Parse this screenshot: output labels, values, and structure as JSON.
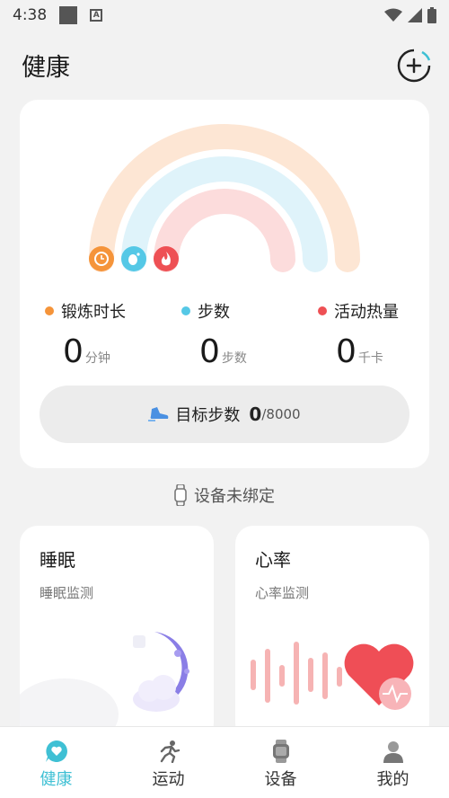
{
  "status_bar": {
    "time": "4:38"
  },
  "header": {
    "title": "健康"
  },
  "activity": {
    "colors": {
      "exercise": "#f5943a",
      "steps": "#55c8e6",
      "calories": "#ee5054"
    },
    "stats": [
      {
        "label": "锻炼时长",
        "value": "0",
        "unit": "分钟"
      },
      {
        "label": "步数",
        "value": "0",
        "unit": "步数"
      },
      {
        "label": "活动热量",
        "value": "0",
        "unit": "千卡"
      }
    ],
    "goal": {
      "label": "目标步数",
      "value": "0",
      "total": "/8000"
    }
  },
  "device": {
    "hint": "设备未绑定"
  },
  "sleep": {
    "title": "睡眠",
    "subtitle": "睡眠监测"
  },
  "heart": {
    "title": "心率",
    "subtitle": "心率监测"
  },
  "nav": {
    "items": [
      {
        "label": "健康",
        "active": true
      },
      {
        "label": "运动",
        "active": false
      },
      {
        "label": "设备",
        "active": false
      },
      {
        "label": "我的",
        "active": false
      }
    ],
    "active_color": "#3fc0d4"
  }
}
